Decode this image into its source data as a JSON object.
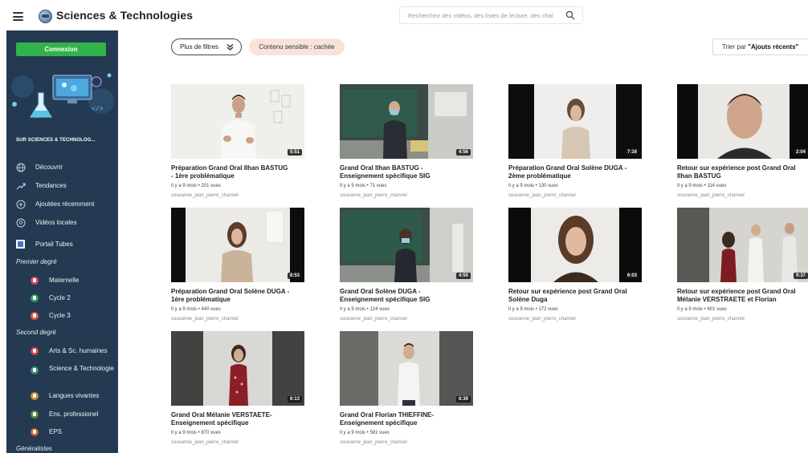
{
  "header": {
    "site_title": "Sciences & Technologies",
    "search_placeholder": "Recherchez des vidéos, des listes de lecture, des chaî",
    "icons": {
      "menu": "hamburger-icon",
      "logo": "globe-logo",
      "search": "search-icon"
    }
  },
  "sidebar": {
    "login_label": "Connexion",
    "about_label": "SUR SCIENCES & TECHNOLOG...",
    "nav": [
      {
        "label": "Découvrir",
        "icon": "globe-icon"
      },
      {
        "label": "Tendances",
        "icon": "trending-icon"
      },
      {
        "label": "Ajoutées récemment",
        "icon": "plus-circle-icon"
      },
      {
        "label": "Vidéos locales",
        "icon": "location-icon"
      },
      {
        "label": "Portail Tubes",
        "icon": "tube-icon"
      }
    ],
    "sections": [
      {
        "title": "Premier degré",
        "items": [
          "Maternelle",
          "Cycle 2",
          "Cycle 3"
        ]
      },
      {
        "title": "Second degré",
        "items": [
          "Arts & Sc. humaines",
          "Science & Technologie",
          "Langues vivantes",
          "Ens. professionel",
          "EPS"
        ]
      },
      {
        "title": "Généralistes",
        "items": []
      }
    ],
    "colors": {
      "background": "#233a52",
      "login": "#32b34a"
    }
  },
  "toolbar": {
    "filters_label": "Plus de filtres",
    "sensitive_label": "Contenu sensible : cachée",
    "sort_prefix": "Trier par",
    "sort_value": "\"Ajouts récents\""
  },
  "videos": [
    {
      "title": "Préparation Grand Oral Ilhan BASTUG - 1ère problématique",
      "duration": "5:51",
      "meta": "Il y a 9 mois • 201 vues",
      "channel": "souvanne_jean_pierre_channel"
    },
    {
      "title": "Grand Oral Ilhan BASTUG - Enseignement spécifique SIG",
      "duration": "4:56",
      "meta": "Il y a 9 mois • 71 vues",
      "channel": "souvanne_jean_pierre_channel"
    },
    {
      "title": "Préparation Grand Oral Solène DUGA - 2ème problématique",
      "duration": "7:16",
      "meta": "Il y a 9 mois • 130 vues",
      "channel": "souvanne_jean_pierre_channel"
    },
    {
      "title": "Retour sur expérience post Grand Oral Ilhan BASTUG",
      "duration": "2:04",
      "meta": "Il y a 9 mois • 114 vues",
      "channel": "souvanne_jean_pierre_channel"
    },
    {
      "title": "Préparation Grand Oral Solène DUGA - 1ère problématique",
      "duration": "8:53",
      "meta": "Il y a 9 mois • 440 vues",
      "channel": "souvanne_jean_pierre_channel"
    },
    {
      "title": "Grand Oral Solène DUGA - Enseignement spécifique SIG",
      "duration": "4:50",
      "meta": "Il y a 9 mois • 124 vues",
      "channel": "souvanne_jean_pierre_channel"
    },
    {
      "title": "Retour sur expérience post Grand Oral Solène Duga",
      "duration": "6:03",
      "meta": "Il y a 9 mois • 172 vues",
      "channel": "souvanne_jean_pierre_channel"
    },
    {
      "title": "Retour sur expérience post Grand Oral Mélanie VERSTRAETE et Florian",
      "duration": "9:37",
      "meta": "Il y a 9 mois • 401 vues",
      "channel": "souvanne_jean_pierre_channel"
    },
    {
      "title": "Grand Oral Mélanie VERSTAETE- Enseignement spécifique",
      "duration": "6:13",
      "meta": "Il y a 9 mois • 870 vues",
      "channel": "souvanne_jean_pierre_channel"
    },
    {
      "title": "Grand Oral Florian THIEFFINE- Enseignement spécifique",
      "duration": "6:39",
      "meta": "Il y a 9 mois • 581 vues",
      "channel": "souvanne_jean_pierre_channel"
    }
  ]
}
